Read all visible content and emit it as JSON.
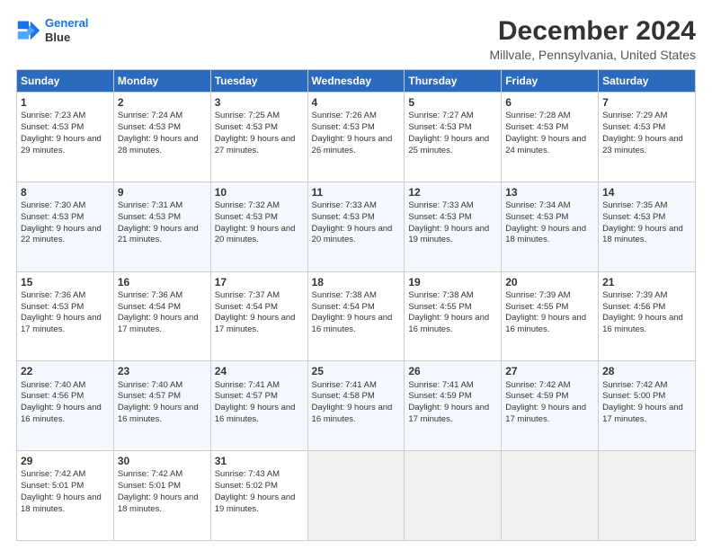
{
  "logo": {
    "line1": "General",
    "line2": "Blue"
  },
  "title": "December 2024",
  "subtitle": "Millvale, Pennsylvania, United States",
  "headers": [
    "Sunday",
    "Monday",
    "Tuesday",
    "Wednesday",
    "Thursday",
    "Friday",
    "Saturday"
  ],
  "weeks": [
    [
      {
        "day": "1",
        "sunrise": "7:23 AM",
        "sunset": "4:53 PM",
        "daylight": "9 hours and 29 minutes."
      },
      {
        "day": "2",
        "sunrise": "7:24 AM",
        "sunset": "4:53 PM",
        "daylight": "9 hours and 28 minutes."
      },
      {
        "day": "3",
        "sunrise": "7:25 AM",
        "sunset": "4:53 PM",
        "daylight": "9 hours and 27 minutes."
      },
      {
        "day": "4",
        "sunrise": "7:26 AM",
        "sunset": "4:53 PM",
        "daylight": "9 hours and 26 minutes."
      },
      {
        "day": "5",
        "sunrise": "7:27 AM",
        "sunset": "4:53 PM",
        "daylight": "9 hours and 25 minutes."
      },
      {
        "day": "6",
        "sunrise": "7:28 AM",
        "sunset": "4:53 PM",
        "daylight": "9 hours and 24 minutes."
      },
      {
        "day": "7",
        "sunrise": "7:29 AM",
        "sunset": "4:53 PM",
        "daylight": "9 hours and 23 minutes."
      }
    ],
    [
      {
        "day": "8",
        "sunrise": "7:30 AM",
        "sunset": "4:53 PM",
        "daylight": "9 hours and 22 minutes."
      },
      {
        "day": "9",
        "sunrise": "7:31 AM",
        "sunset": "4:53 PM",
        "daylight": "9 hours and 21 minutes."
      },
      {
        "day": "10",
        "sunrise": "7:32 AM",
        "sunset": "4:53 PM",
        "daylight": "9 hours and 20 minutes."
      },
      {
        "day": "11",
        "sunrise": "7:33 AM",
        "sunset": "4:53 PM",
        "daylight": "9 hours and 20 minutes."
      },
      {
        "day": "12",
        "sunrise": "7:33 AM",
        "sunset": "4:53 PM",
        "daylight": "9 hours and 19 minutes."
      },
      {
        "day": "13",
        "sunrise": "7:34 AM",
        "sunset": "4:53 PM",
        "daylight": "9 hours and 18 minutes."
      },
      {
        "day": "14",
        "sunrise": "7:35 AM",
        "sunset": "4:53 PM",
        "daylight": "9 hours and 18 minutes."
      }
    ],
    [
      {
        "day": "15",
        "sunrise": "7:36 AM",
        "sunset": "4:53 PM",
        "daylight": "9 hours and 17 minutes."
      },
      {
        "day": "16",
        "sunrise": "7:36 AM",
        "sunset": "4:54 PM",
        "daylight": "9 hours and 17 minutes."
      },
      {
        "day": "17",
        "sunrise": "7:37 AM",
        "sunset": "4:54 PM",
        "daylight": "9 hours and 17 minutes."
      },
      {
        "day": "18",
        "sunrise": "7:38 AM",
        "sunset": "4:54 PM",
        "daylight": "9 hours and 16 minutes."
      },
      {
        "day": "19",
        "sunrise": "7:38 AM",
        "sunset": "4:55 PM",
        "daylight": "9 hours and 16 minutes."
      },
      {
        "day": "20",
        "sunrise": "7:39 AM",
        "sunset": "4:55 PM",
        "daylight": "9 hours and 16 minutes."
      },
      {
        "day": "21",
        "sunrise": "7:39 AM",
        "sunset": "4:56 PM",
        "daylight": "9 hours and 16 minutes."
      }
    ],
    [
      {
        "day": "22",
        "sunrise": "7:40 AM",
        "sunset": "4:56 PM",
        "daylight": "9 hours and 16 minutes."
      },
      {
        "day": "23",
        "sunrise": "7:40 AM",
        "sunset": "4:57 PM",
        "daylight": "9 hours and 16 minutes."
      },
      {
        "day": "24",
        "sunrise": "7:41 AM",
        "sunset": "4:57 PM",
        "daylight": "9 hours and 16 minutes."
      },
      {
        "day": "25",
        "sunrise": "7:41 AM",
        "sunset": "4:58 PM",
        "daylight": "9 hours and 16 minutes."
      },
      {
        "day": "26",
        "sunrise": "7:41 AM",
        "sunset": "4:59 PM",
        "daylight": "9 hours and 17 minutes."
      },
      {
        "day": "27",
        "sunrise": "7:42 AM",
        "sunset": "4:59 PM",
        "daylight": "9 hours and 17 minutes."
      },
      {
        "day": "28",
        "sunrise": "7:42 AM",
        "sunset": "5:00 PM",
        "daylight": "9 hours and 17 minutes."
      }
    ],
    [
      {
        "day": "29",
        "sunrise": "7:42 AM",
        "sunset": "5:01 PM",
        "daylight": "9 hours and 18 minutes."
      },
      {
        "day": "30",
        "sunrise": "7:42 AM",
        "sunset": "5:01 PM",
        "daylight": "9 hours and 18 minutes."
      },
      {
        "day": "31",
        "sunrise": "7:43 AM",
        "sunset": "5:02 PM",
        "daylight": "9 hours and 19 minutes."
      },
      null,
      null,
      null,
      null
    ]
  ]
}
